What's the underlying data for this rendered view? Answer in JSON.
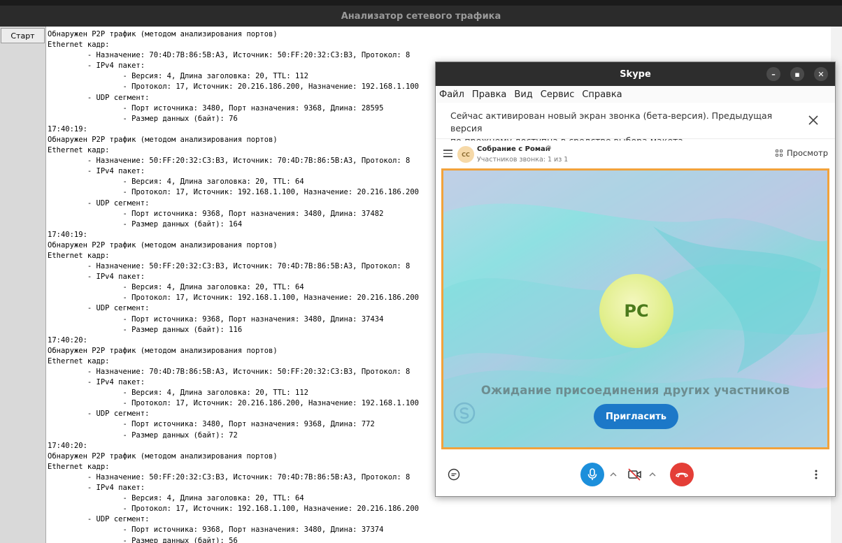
{
  "analyzer": {
    "title": "Анализатор сетевого трафика",
    "start_button": "Старт",
    "log_text": "Обнаружен P2P трафик (методом анализирования портов)\nEthernet кадр:\n         - Назначение: 70:4D:7B:86:5B:A3, Источник: 50:FF:20:32:C3:B3, Протокол: 8\n         - IPv4 пакет:\n                 - Версия: 4, Длина заголовка: 20, TTL: 112\n                 - Протокол: 17, Источник: 20.216.186.200, Назначение: 192.168.1.100\n         - UDP сегмент:\n                 - Порт источника: 3480, Порт назначения: 9368, Длина: 28595\n                 - Размер данных (байт): 76\n17:40:19:\nОбнаружен P2P трафик (методом анализирования портов)\nEthernet кадр:\n         - Назначение: 50:FF:20:32:C3:B3, Источник: 70:4D:7B:86:5B:A3, Протокол: 8\n         - IPv4 пакет:\n                 - Версия: 4, Длина заголовка: 20, TTL: 64\n                 - Протокол: 17, Источник: 192.168.1.100, Назначение: 20.216.186.200\n         - UDP сегмент:\n                 - Порт источника: 9368, Порт назначения: 3480, Длина: 37482\n                 - Размер данных (байт): 164\n17:40:19:\nОбнаружен P2P трафик (методом анализирования портов)\nEthernet кадр:\n         - Назначение: 50:FF:20:32:C3:B3, Источник: 70:4D:7B:86:5B:A3, Протокол: 8\n         - IPv4 пакет:\n                 - Версия: 4, Длина заголовка: 20, TTL: 64\n                 - Протокол: 17, Источник: 192.168.1.100, Назначение: 20.216.186.200\n         - UDP сегмент:\n                 - Порт источника: 9368, Порт назначения: 3480, Длина: 37434\n                 - Размер данных (байт): 116\n17:40:20:\nОбнаружен P2P трафик (методом анализирования портов)\nEthernet кадр:\n         - Назначение: 70:4D:7B:86:5B:A3, Источник: 50:FF:20:32:C3:B3, Протокол: 8\n         - IPv4 пакет:\n                 - Версия: 4, Длина заголовка: 20, TTL: 112\n                 - Протокол: 17, Источник: 20.216.186.200, Назначение: 192.168.1.100\n         - UDP сегмент:\n                 - Порт источника: 3480, Порт назначения: 9368, Длина: 772\n                 - Размер данных (байт): 72\n17:40:20:\nОбнаружен P2P трафик (методом анализирования портов)\nEthernet кадр:\n         - Назначение: 50:FF:20:32:C3:B3, Источник: 70:4D:7B:86:5B:A3, Протокол: 8\n         - IPv4 пакет:\n                 - Версия: 4, Длина заголовка: 20, TTL: 64\n                 - Протокол: 17, Источник: 192.168.1.100, Назначение: 20.216.186.200\n         - UDP сегмент:\n                 - Порт источника: 9368, Порт назначения: 3480, Длина: 37374\n                 - Размер данных (байт): 56"
  },
  "skype": {
    "title": "Skype",
    "window_buttons": {
      "minimize": "–",
      "maximize": "▪",
      "close": "✕"
    },
    "menu": [
      "Файл",
      "Правка",
      "Вид",
      "Сервис",
      "Справка"
    ],
    "notice": "Сейчас активирован новый экран звонка (бета-версия). Предыдущая версия\nпо-прежнему доступна в средстве выбора макета.",
    "meeting": {
      "avatar_initials": "СС",
      "name": "Собрание с Роман",
      "participants": "Участников звонка: 1 из 1",
      "view_label": "Просмотр"
    },
    "stage": {
      "avatar_initials": "РС",
      "waiting_text": "Ожидание присоединения других участников",
      "invite_label": "Пригласить"
    },
    "colors": {
      "accent": "#1c78c8",
      "border_highlight": "#f2a23b",
      "hangup": "#e43e37",
      "mic": "#1c8fdb"
    }
  }
}
